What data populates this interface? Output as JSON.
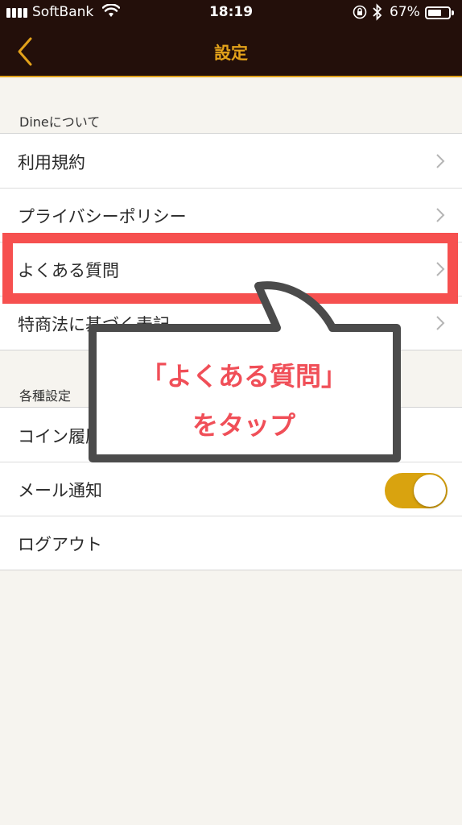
{
  "status_bar": {
    "carrier": "SoftBank",
    "time": "18:19",
    "battery_percent": "67%",
    "battery_level": 0.67
  },
  "nav": {
    "title": "設定",
    "back_icon": "chevron-left-icon",
    "accent_color": "#e3a21a"
  },
  "sections": [
    {
      "header": "Dineについて",
      "rows": [
        {
          "label": "利用規約"
        },
        {
          "label": "プライバシーポリシー"
        },
        {
          "label": "よくある質問"
        },
        {
          "label": "特商法に基づく表記"
        }
      ]
    },
    {
      "header": "各種設定",
      "rows": [
        {
          "label": "コイン履歴"
        },
        {
          "label": "メール通知",
          "toggle_on": true
        },
        {
          "label": "ログアウト"
        }
      ]
    }
  ],
  "annotation": {
    "line1": "「よくある質問」",
    "line2": "をタップ",
    "highlight_color": "#f6504f"
  }
}
